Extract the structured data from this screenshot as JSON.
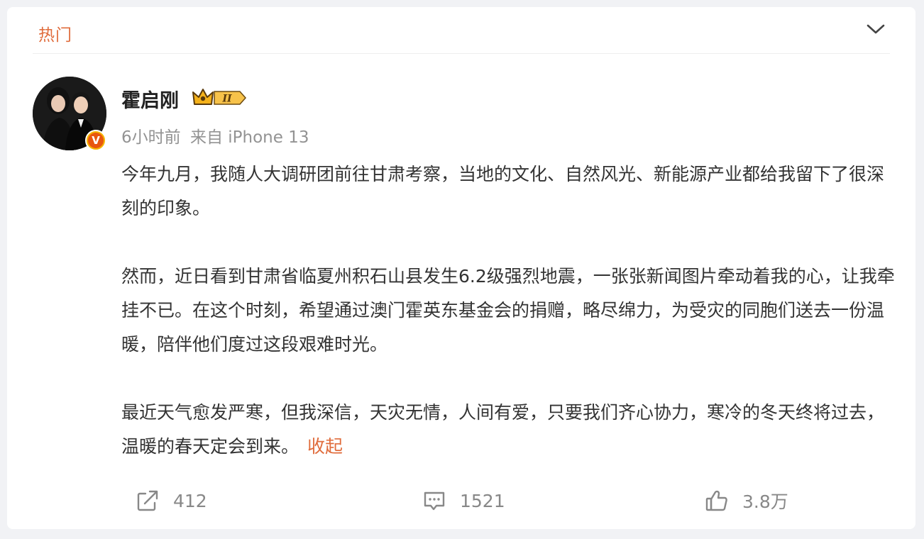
{
  "header": {
    "tab_label": "热门"
  },
  "post": {
    "username": "霍启刚",
    "vip_level": "II",
    "time": "6小时前",
    "source": "来自 iPhone 13",
    "paragraphs": [
      "今年九月，我随人大调研团前往甘肃考察，当地的文化、自然风光、新能源产业都给我留下了很深刻的印象。",
      "然而，近日看到甘肃省临夏州积石山县发生6.2级强烈地震，一张张新闻图片牵动着我的心，让我牵挂不已。在这个时刻，希望通过澳门霍英东基金会的捐赠，略尽绵力，为受灾的同胞们送去一份温暖，陪伴他们度过这段艰难时光。",
      "最近天气愈发严寒，但我深信，天灾无情，人间有爱，只要我们齐心协力，寒冷的冬天终将过去，温暖的春天定会到来。"
    ],
    "collapse_label": "收起",
    "verified_badge": "V"
  },
  "actions": {
    "repost_count": "412",
    "comment_count": "1521",
    "like_count": "3.8万"
  },
  "colors": {
    "accent": "#e06c3c",
    "muted_text": "#939393",
    "body_text": "#333333",
    "background": "#f1f2f5"
  },
  "icons": [
    "chevron-down-icon",
    "crown-icon",
    "verified-icon",
    "repost-icon",
    "comment-icon",
    "like-icon"
  ]
}
